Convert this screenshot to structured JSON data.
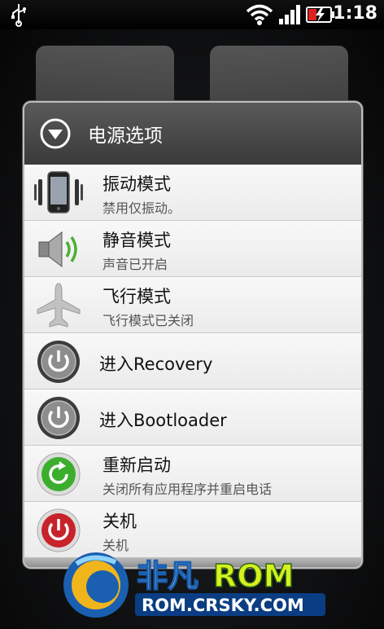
{
  "statusbar": {
    "time": "1:18",
    "icons": [
      "usb-icon",
      "wifi-icon",
      "signal-icon",
      "battery-charging-icon"
    ]
  },
  "dialog": {
    "title": "电源选项",
    "header_icon": "chevron-down-circle-icon",
    "items": [
      {
        "id": "vibrate",
        "icon": "vibrate-phone-icon",
        "title": "振动模式",
        "subtitle": "禁用仅振动。"
      },
      {
        "id": "silent",
        "icon": "speaker-icon",
        "title": "静音模式",
        "subtitle": "声音已开启"
      },
      {
        "id": "airplane",
        "icon": "airplane-icon",
        "title": "飞行模式",
        "subtitle": "飞行模式已关闭"
      },
      {
        "id": "recovery",
        "icon": "power-gray-icon",
        "title": "进入Recovery"
      },
      {
        "id": "bootloader",
        "icon": "power-gray-icon",
        "title": "进入Bootloader"
      },
      {
        "id": "reboot",
        "icon": "reboot-green-icon",
        "title": "重新启动",
        "subtitle": "关闭所有应用程序并重启电话"
      },
      {
        "id": "shutdown",
        "icon": "power-red-icon",
        "title": "关机",
        "subtitle": "关机"
      }
    ]
  },
  "watermark": {
    "brand": "非凡ROM",
    "url": "ROM.CRSKY.COM"
  },
  "colors": {
    "header_bg": "#4a4a4a",
    "list_bg": "#f0f0f0",
    "reboot_green": "#3cae2e",
    "shutdown_red": "#c8222a"
  }
}
